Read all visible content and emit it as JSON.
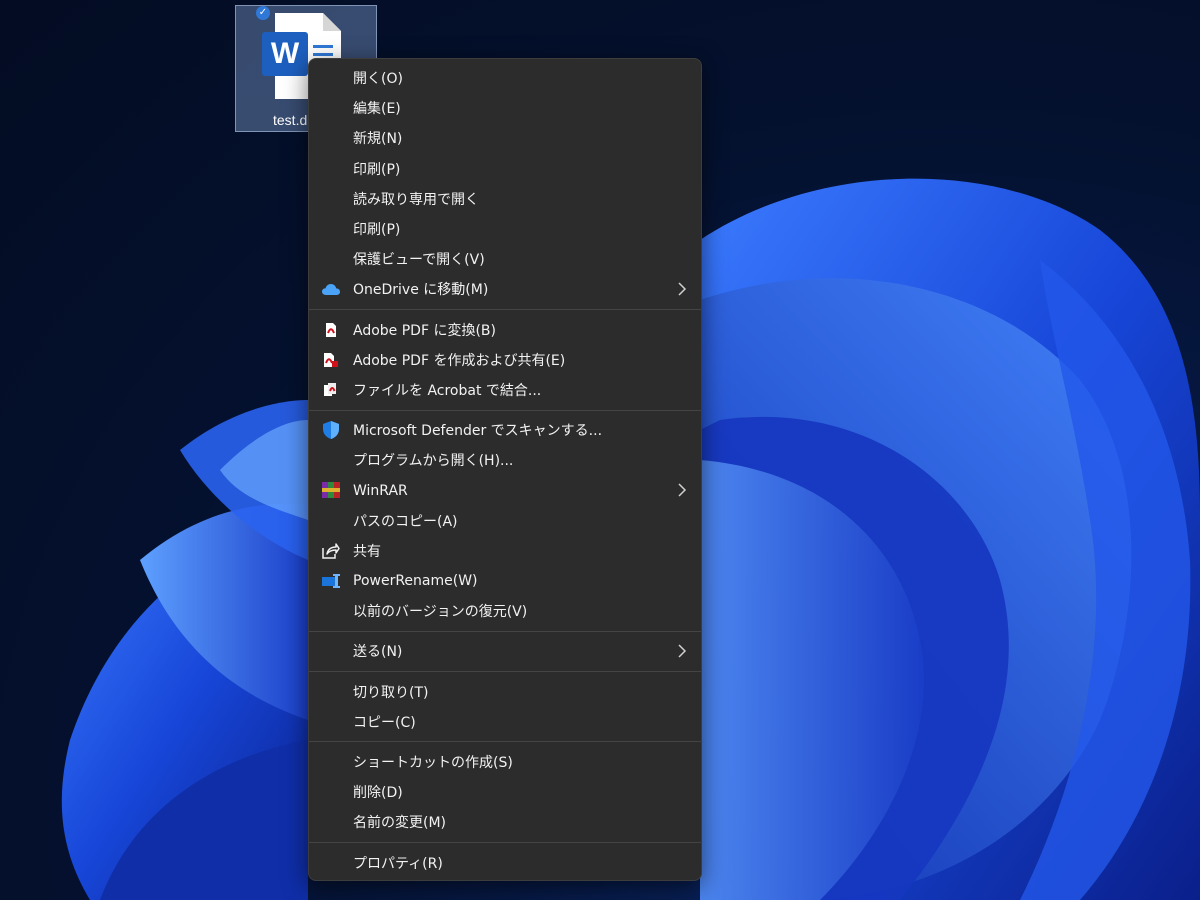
{
  "desktop": {
    "file": {
      "name": "test.d"
    }
  },
  "menu": {
    "groups": [
      [
        {
          "label": "開く(O)",
          "icon": "",
          "submenu": false
        },
        {
          "label": "編集(E)",
          "icon": "",
          "submenu": false
        },
        {
          "label": "新規(N)",
          "icon": "",
          "submenu": false
        },
        {
          "label": "印刷(P)",
          "icon": "",
          "submenu": false
        },
        {
          "label": "読み取り専用で開く",
          "icon": "",
          "submenu": false
        },
        {
          "label": "印刷(P)",
          "icon": "",
          "submenu": false
        },
        {
          "label": "保護ビューで開く(V)",
          "icon": "",
          "submenu": false
        },
        {
          "label": "OneDrive に移動(M)",
          "icon": "onedrive-cloud-icon",
          "submenu": true
        }
      ],
      [
        {
          "label": "Adobe PDF に変換(B)",
          "icon": "adobe-pdf-icon",
          "submenu": false
        },
        {
          "label": "Adobe PDF を作成および共有(E)",
          "icon": "adobe-pdf-share-icon",
          "submenu": false
        },
        {
          "label": "ファイルを Acrobat で結合...",
          "icon": "acrobat-combine-icon",
          "submenu": false
        }
      ],
      [
        {
          "label": "Microsoft Defender でスキャンする...",
          "icon": "defender-shield-icon",
          "submenu": false
        },
        {
          "label": "プログラムから開く(H)...",
          "icon": "",
          "submenu": false
        },
        {
          "label": "WinRAR",
          "icon": "winrar-icon",
          "submenu": true
        },
        {
          "label": "パスのコピー(A)",
          "icon": "",
          "submenu": false
        },
        {
          "label": "共有",
          "icon": "share-icon",
          "submenu": false
        },
        {
          "label": "PowerRename(W)",
          "icon": "powerrename-icon",
          "submenu": false
        },
        {
          "label": "以前のバージョンの復元(V)",
          "icon": "",
          "submenu": false
        }
      ],
      [
        {
          "label": "送る(N)",
          "icon": "",
          "submenu": true
        }
      ],
      [
        {
          "label": "切り取り(T)",
          "icon": "",
          "submenu": false
        },
        {
          "label": "コピー(C)",
          "icon": "",
          "submenu": false
        }
      ],
      [
        {
          "label": "ショートカットの作成(S)",
          "icon": "",
          "submenu": false
        },
        {
          "label": "削除(D)",
          "icon": "",
          "submenu": false
        },
        {
          "label": "名前の変更(M)",
          "icon": "",
          "submenu": false
        }
      ],
      [
        {
          "label": "プロパティ(R)",
          "icon": "",
          "submenu": false
        }
      ]
    ]
  },
  "colors": {
    "menu_bg": "#2c2c2c",
    "menu_text": "#f2f2f2",
    "separator": "#444444",
    "accent": "#1d5fbf",
    "desktop_bg": "#04112f"
  }
}
